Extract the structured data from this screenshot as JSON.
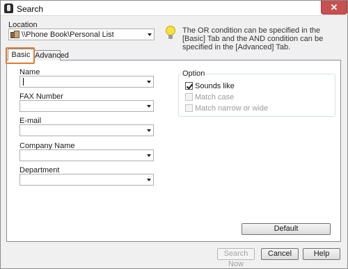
{
  "window": {
    "title": "Search",
    "close_glyph": "✕"
  },
  "location": {
    "label": "Location",
    "value": "\\\\Phone Book\\Personal List",
    "icon": "phone-book-folder-icon"
  },
  "hint": {
    "text": "The OR condition can be specified in the [Basic] Tab and the AND condition can be specified in the [Advanced] Tab.",
    "icon": "lightbulb-icon"
  },
  "tabs": [
    {
      "label": "Basic",
      "selected": true
    },
    {
      "label": "Advanced",
      "selected": false
    }
  ],
  "fields": {
    "name": {
      "label": "Name",
      "value": ""
    },
    "fax": {
      "label": "FAX Number",
      "value": ""
    },
    "email": {
      "label": "E-mail",
      "value": ""
    },
    "company": {
      "label": "Company Name",
      "value": ""
    },
    "department": {
      "label": "Department",
      "value": ""
    }
  },
  "option": {
    "title": "Option",
    "sounds_like": {
      "label": "Sounds like",
      "checked": true
    },
    "match_case": {
      "label": "Match case",
      "checked": false
    },
    "match_narrow": {
      "label": "Match narrow or wide",
      "checked": false
    }
  },
  "buttons": {
    "default": "Default",
    "search_now": "Search Now",
    "cancel": "Cancel",
    "help": "Help"
  },
  "colors": {
    "highlight": "#e07b2d",
    "close_button": "#c75050"
  }
}
